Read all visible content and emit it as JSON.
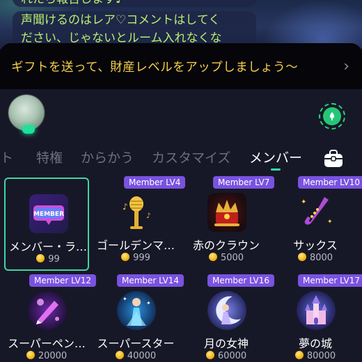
{
  "chat": {
    "line_top": "れたら報告します♪",
    "line_main": "声聞けるのはレア♡コメントはしてく",
    "line_cut": "ださい、じゃないとルーム入れなくな"
  },
  "promo": {
    "text": "ギフトを送って、財産レベルをアップしましょう〜",
    "chevron": "›"
  },
  "tabs": {
    "items": [
      "ト",
      "特権",
      "からかう",
      "カスタマイズ",
      "メンバー"
    ],
    "active": "メンバー"
  },
  "gifts": [
    {
      "name": "メンバー・ラ…",
      "price": "99",
      "tag": "",
      "icon": "member-badge-icon"
    },
    {
      "name": "ゴールデンマ…",
      "price": "999",
      "tag": "Member LV4",
      "icon": "golden-mic-icon"
    },
    {
      "name": "赤のクラウン",
      "price": "5000",
      "tag": "Member LV7",
      "icon": "red-crown-icon"
    },
    {
      "name": "サックス",
      "price": "8000",
      "tag": "Member LV10",
      "icon": "saxophone-icon"
    },
    {
      "name": "スーパーペン…",
      "price": "20000",
      "tag": "Member LV12",
      "icon": "super-pen-icon"
    },
    {
      "name": "スーパースター",
      "price": "40000",
      "tag": "Member LV14",
      "icon": "superstar-icon"
    },
    {
      "name": "月の女神",
      "price": "60000",
      "tag": "Member LV16",
      "icon": "moon-goddess-icon"
    },
    {
      "name": "夢の城",
      "price": "80000",
      "tag": "Member LV17",
      "icon": "dream-castle-icon"
    }
  ],
  "colors": {
    "accent": "#3fd6a2",
    "tag_purple": "#7a52e0",
    "promo_gold": "#f5cf4a",
    "chat_green": "#b7ef6f"
  }
}
